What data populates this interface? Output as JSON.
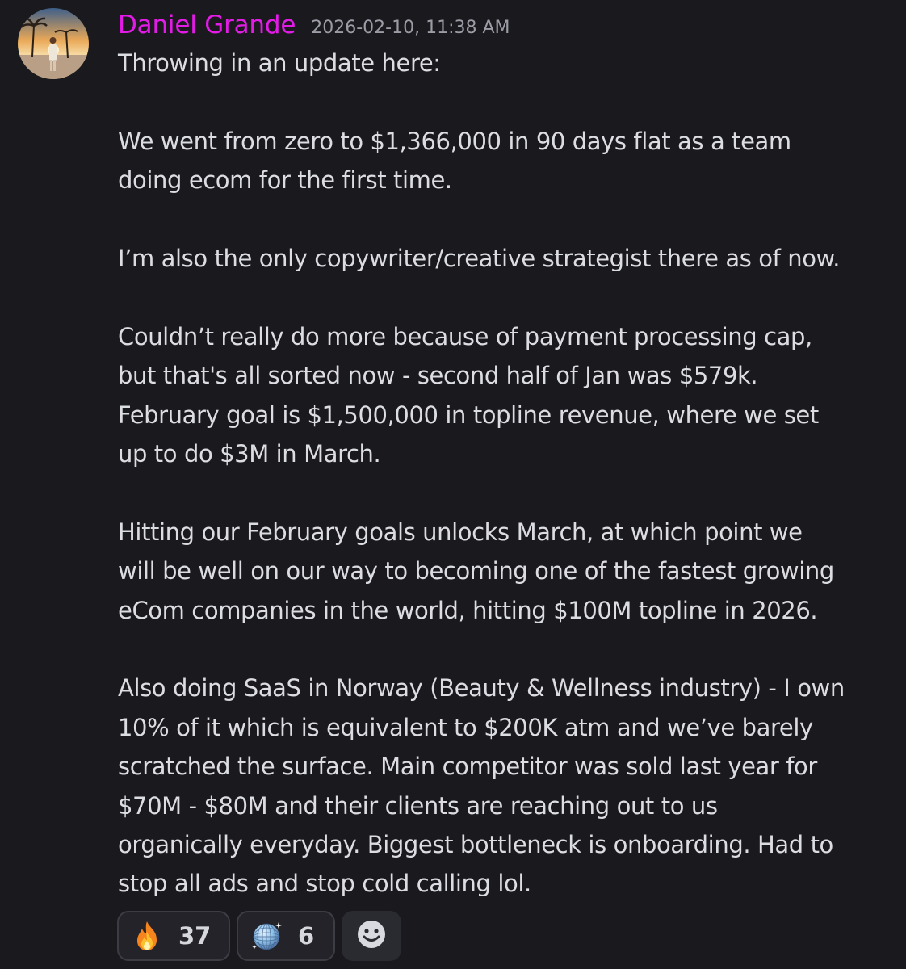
{
  "message": {
    "author": "Daniel Grande",
    "timestamp": "2026-02-10, 11:38 AM",
    "paragraphs": [
      "Throwing in an update here:",
      "We went from zero to $1,366,000 in 90 days flat as a team\ndoing ecom for the first time.",
      "I’m also the only copywriter/creative strategist there as of now.",
      "Couldn’t really do more because of payment processing cap,\nbut that's all sorted now - second half of Jan was $579k.\nFebruary goal is $1,500,000 in topline revenue, where we set\nup to do $3M in March.",
      "Hitting our February goals unlocks March, at which point we\nwill be well on our way to becoming one of the fastest growing\neCom companies in the world, hitting $100M topline in 2026.",
      "Also doing SaaS in Norway (Beauty & Wellness industry) - I own\n10% of it which is equivalent to $200K atm and we’ve barely\nscratched the surface. Main competitor was sold last year for\n$70M - $80M and their clients are reaching out to us\norganically everyday. Biggest bottleneck is onboarding. Had to\nstop all ads and stop cold calling lol."
    ]
  },
  "reactions": [
    {
      "icon": "fire-icon",
      "count": "37"
    },
    {
      "icon": "mirror-ball-icon",
      "count": "6"
    }
  ],
  "add_reaction_icon": "smiley-icon",
  "colors": {
    "background": "#1a1a1e",
    "username": "#e21be6",
    "text": "#dcdde3",
    "timestamp": "#9c9ca6"
  }
}
